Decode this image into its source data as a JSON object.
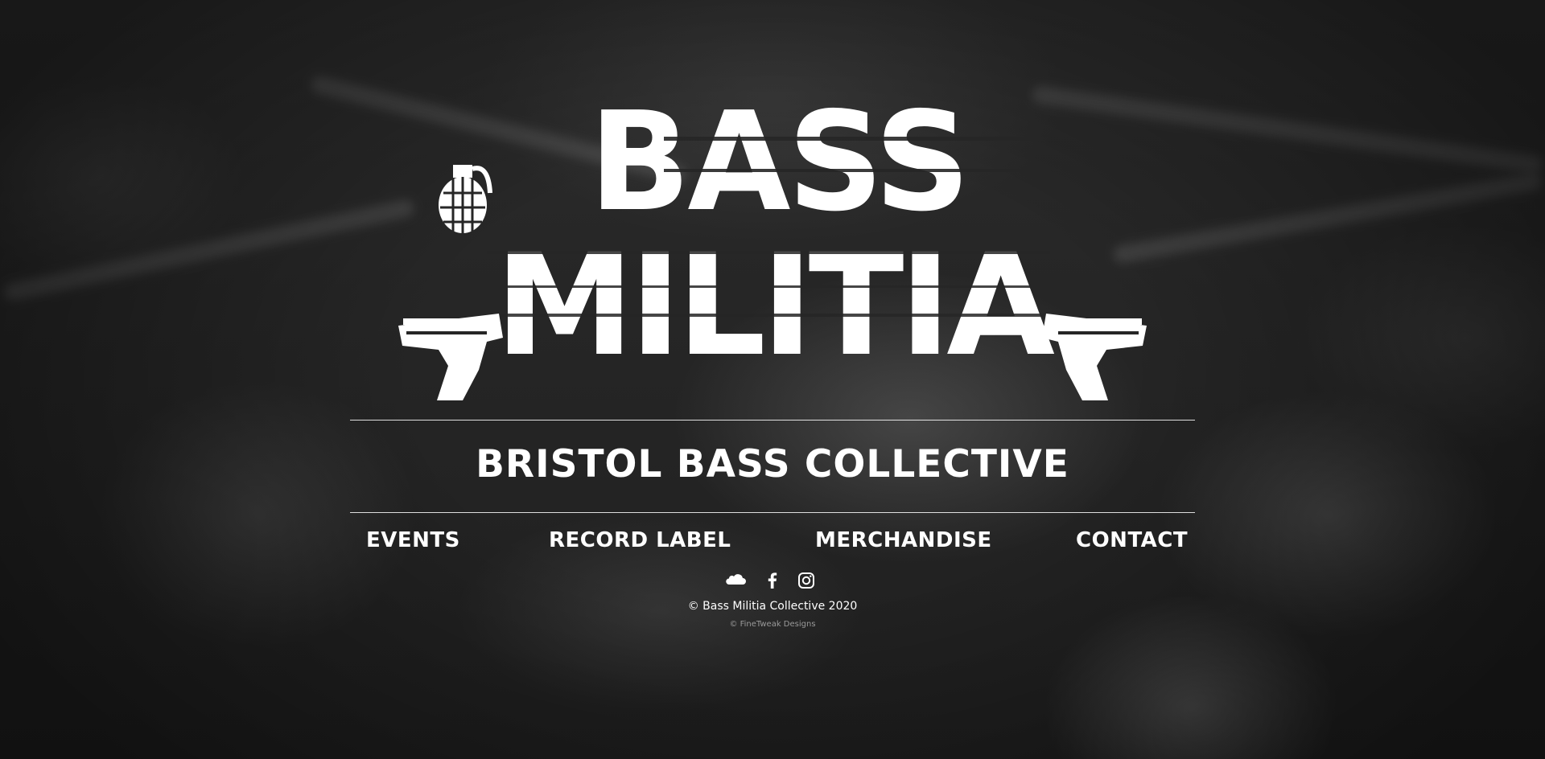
{
  "logo": {
    "line1": "BASS",
    "line2": "MILITIA",
    "icons": [
      "grenade-icon",
      "pistol-left-icon",
      "pistol-right-icon"
    ]
  },
  "tagline": "BRISTOL BASS COLLECTIVE",
  "nav": {
    "items": [
      {
        "label": "EVENTS"
      },
      {
        "label": "RECORD LABEL"
      },
      {
        "label": "MERCHANDISE"
      },
      {
        "label": "CONTACT"
      }
    ]
  },
  "socials": [
    "soundcloud-icon",
    "facebook-icon",
    "instagram-icon"
  ],
  "footer": {
    "copyright": "© Bass Militia Collective 2020",
    "credit": "© FineTweak Designs"
  },
  "colors": {
    "text": "#ffffff",
    "muted": "#9a9a9a",
    "background": "#262626"
  }
}
